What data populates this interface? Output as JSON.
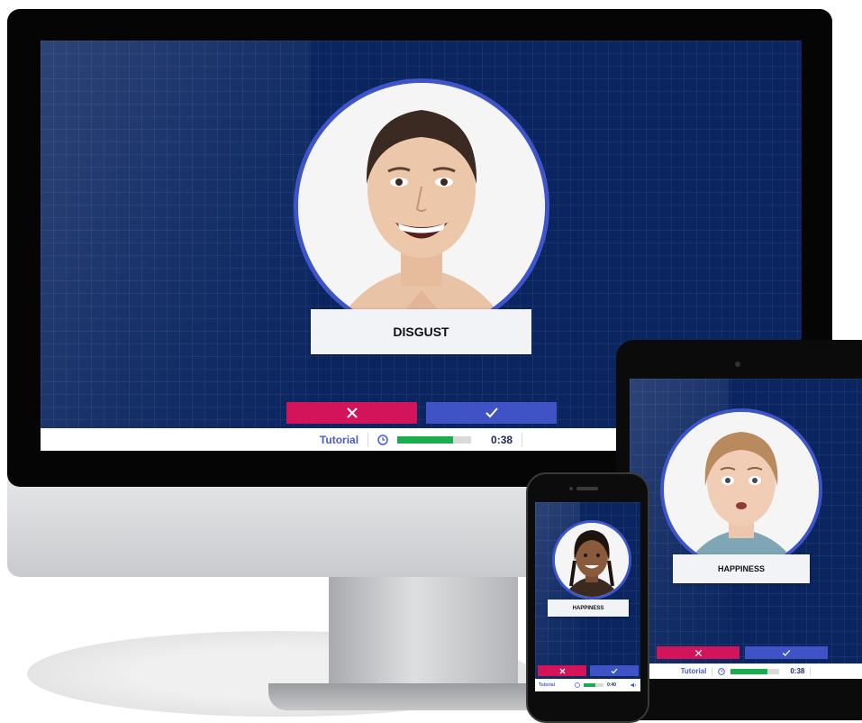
{
  "monitor": {
    "label": "DISGUST",
    "reject_icon": "close-icon",
    "accept_icon": "checkmark-icon",
    "status": {
      "tutorial": "Tutorial",
      "time": "0:38",
      "progress": 0.75
    }
  },
  "tablet": {
    "label": "HAPPINESS",
    "reject_icon": "close-icon",
    "accept_icon": "checkmark-icon",
    "status": {
      "tutorial": "Tutorial",
      "time": "0:38",
      "progress": 0.75
    }
  },
  "phone": {
    "label": "HAPPINESS",
    "reject_icon": "close-icon",
    "accept_icon": "checkmark-icon",
    "status": {
      "tutorial": "Tutorial",
      "time": "0:40",
      "progress": 0.6
    }
  },
  "colors": {
    "screen_bg": "#0a2560",
    "circle_border": "#3e55c9",
    "reject": "#d4145a",
    "accept": "#3f53c6",
    "progress": "#1aad4e",
    "tutorial_text": "#4a5bc4"
  }
}
